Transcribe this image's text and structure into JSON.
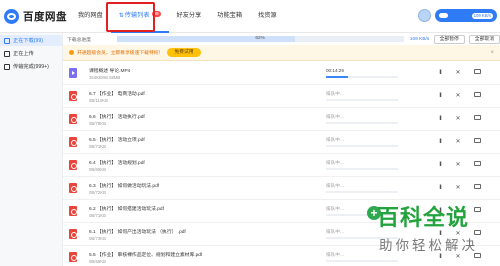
{
  "header": {
    "logo_text": "百度网盘",
    "nav": [
      {
        "label": "我的网盘"
      },
      {
        "label": "传输列表",
        "badge": "99"
      },
      {
        "label": "好友分享"
      },
      {
        "label": "功能宝箱"
      },
      {
        "label": "找资源"
      }
    ],
    "vip": {
      "speed": "109 KB/s"
    }
  },
  "sidebar": {
    "items": [
      {
        "label": "正在下载(99)"
      },
      {
        "label": "正在上传"
      },
      {
        "label": "传输完成(999+)"
      }
    ]
  },
  "progress": {
    "label": "下载总进度",
    "percent_text": "62%",
    "percent": 62,
    "speed": "109 KB/s",
    "pause_all": "全部暂停",
    "cancel_all": "全部取消"
  },
  "notice": {
    "text": "开通超级会员，立即尊享极速下载特权！",
    "button": "免费试用"
  },
  "files": [
    {
      "type": "video",
      "name": "课程概述 导论.MP4",
      "size": "354KB/96.58MB",
      "status": "00:14:29",
      "is_active": true,
      "progress": 0.3
    },
    {
      "type": "pdf",
      "name": "6.7 【作业】 电商活动.pdf",
      "size": "0B/110KB",
      "status": "排队中…",
      "is_active": false
    },
    {
      "type": "pdf",
      "name": "6.6 【执行】 活动执行.pdf",
      "size": "0B/78KB",
      "status": "排队中…",
      "is_active": false
    },
    {
      "type": "pdf",
      "name": "6.5 【执行】 活动立项.pdf",
      "size": "0B/71KB",
      "status": "排队中…",
      "is_active": false
    },
    {
      "type": "pdf",
      "name": "6.4 【执行】 活动规划.pdf",
      "size": "0B/65KB",
      "status": "排队中…",
      "is_active": false
    },
    {
      "type": "pdf",
      "name": "6.3 【执行】 如何做活动玩法.pdf",
      "size": "0B/72KB",
      "status": "排队中…",
      "is_active": false
    },
    {
      "type": "pdf",
      "name": "6.2 【执行】 如何搭建活动玩法.pdf",
      "size": "0B/71KB",
      "status": "排队中…",
      "is_active": false
    },
    {
      "type": "pdf",
      "name": "6.1 【执行】 如何产出活动玩法 （执行） .pdf",
      "size": "0B/73KB",
      "status": "排队中…",
      "is_active": false
    },
    {
      "type": "pdf",
      "name": "5.5 【作业】 审核裸作品定位、规划和建立素材库.pdf",
      "size": "0B/66KB",
      "status": "排队中…",
      "is_active": false
    }
  ],
  "watermark": {
    "title": "百科全说",
    "subtitle": "助你轻松解决"
  },
  "colors": {
    "accent": "#2f7bf6",
    "highlight": "#e02020",
    "notice_bg": "#fff7e6",
    "pdf": "#e8453c"
  }
}
